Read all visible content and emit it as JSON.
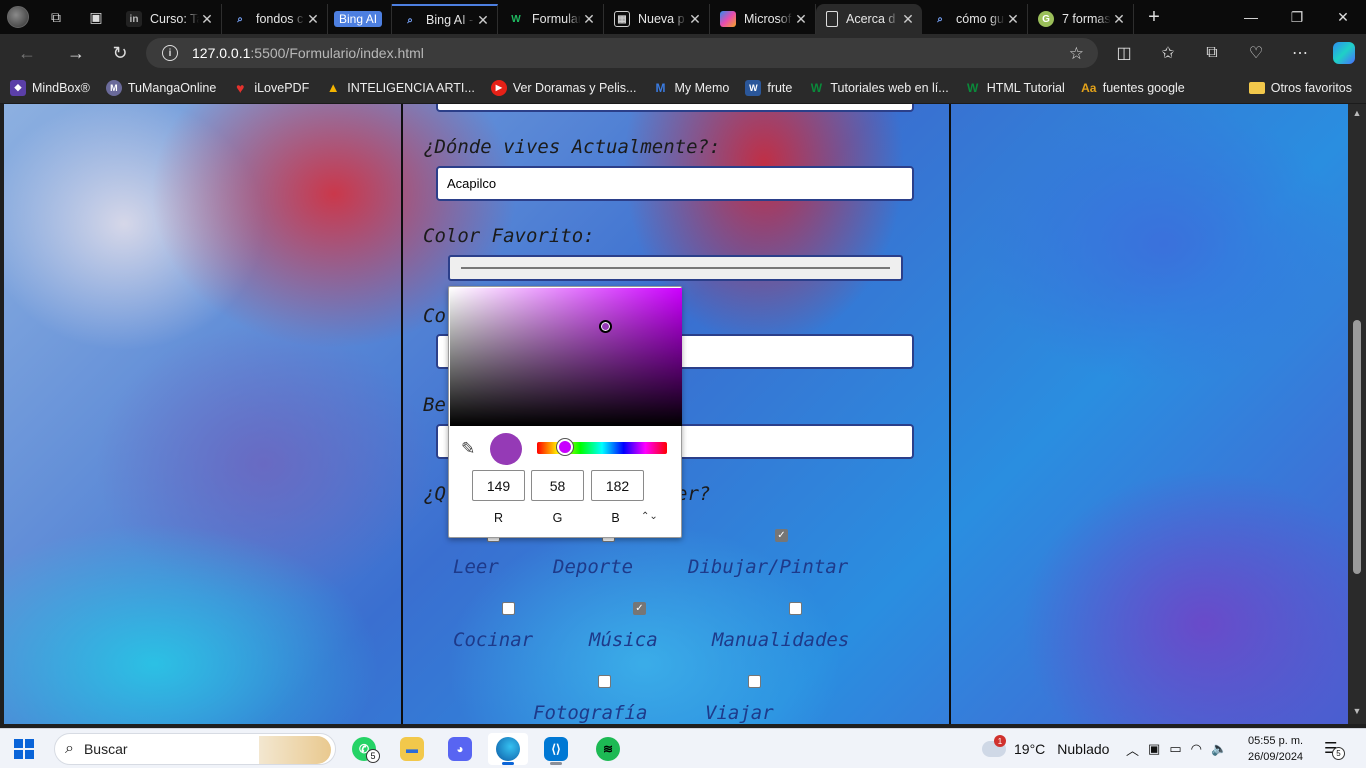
{
  "browser": {
    "tabs": [
      {
        "title": "Curso: Ta",
        "favicon": "in"
      },
      {
        "title": "fondos c",
        "favicon": "search"
      },
      {
        "title": "Bing AI",
        "favicon": "bing-pill"
      },
      {
        "title": "Bing AI -",
        "favicon": "search"
      },
      {
        "title": "Formular",
        "favicon": "W"
      },
      {
        "title": "Nueva p",
        "favicon": "calendar"
      },
      {
        "title": "Microsof",
        "favicon": "copilot"
      },
      {
        "title": "Acerca d",
        "favicon": "page",
        "active": true
      },
      {
        "title": "cómo gu",
        "favicon": "search"
      },
      {
        "title": "7 formas",
        "favicon": "G"
      }
    ],
    "address": {
      "host": "127.0.0.1",
      "path": ":5500/Formulario/index.html"
    },
    "favorites": [
      {
        "label": "MindBox®",
        "color": "#5b3fa8"
      },
      {
        "label": "TuMangaOnline",
        "color": "#6a6a9a"
      },
      {
        "label": "iLovePDF",
        "color": "#e5322d"
      },
      {
        "label": "INTELIGENCIA ARTI...",
        "color": "#1fa463"
      },
      {
        "label": "Ver Doramas y Pelis...",
        "color": "#e62117"
      },
      {
        "label": "My Memo",
        "color": "#3a7be0"
      },
      {
        "label": "frute",
        "color": "#2b579a"
      },
      {
        "label": "Tutoriales web en lí...",
        "color": "#0a8a3a"
      },
      {
        "label": "HTML Tutorial",
        "color": "#0a8a3a"
      },
      {
        "label": "fuentes google",
        "color": "#e3a21a"
      }
    ],
    "favorites_other": "Otros favoritos"
  },
  "form": {
    "q_live": "¿Dónde vives Actualmente?:",
    "live_value": "Acapilco",
    "q_color": "Color Favorito:",
    "q_hidden1": "Co",
    "q_hidden2": "Be",
    "q_hobbies_start": "¿Q",
    "q_hobbies_end": "er?",
    "hobbies": [
      {
        "label": "Leer",
        "checked": false
      },
      {
        "label": "Deporte",
        "checked": false
      },
      {
        "label": "Dibujar/Pintar",
        "checked": true
      },
      {
        "label": "Cocinar",
        "checked": false
      },
      {
        "label": "Música",
        "checked": true
      },
      {
        "label": "Manualidades",
        "checked": false
      },
      {
        "label": "Fotografía",
        "checked": false
      },
      {
        "label": "Viajar",
        "checked": false
      }
    ]
  },
  "color_picker": {
    "r": "149",
    "g": "58",
    "b": "182",
    "r_label": "R",
    "g_label": "G",
    "b_label": "B",
    "current_color": "#953ab6"
  },
  "taskbar": {
    "search_placeholder": "Buscar",
    "weather_temp": "19°C",
    "weather_text": "Nublado",
    "weather_alert": "1",
    "time": "05:55 p. m.",
    "date": "26/09/2024",
    "whatsapp_badge": "5",
    "notif_badge": "5"
  }
}
